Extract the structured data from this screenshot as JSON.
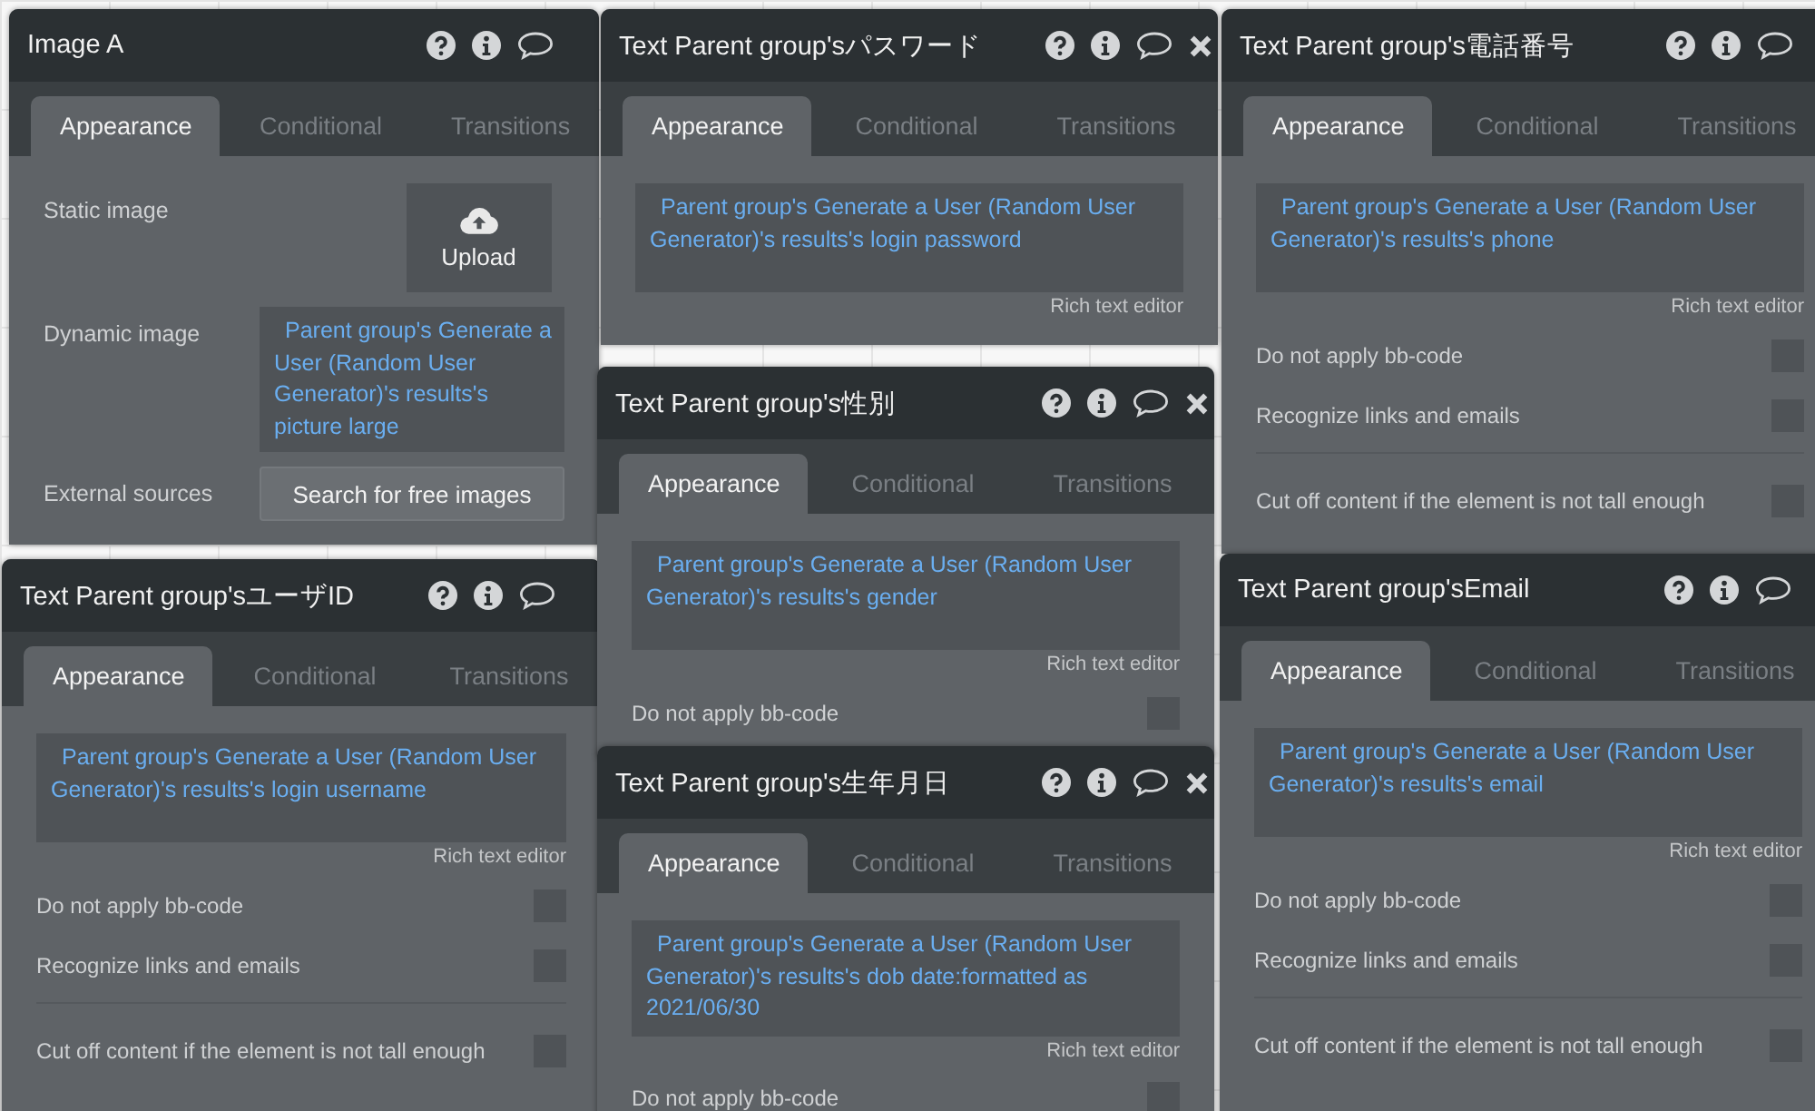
{
  "windows": [
    {
      "title": "Image A",
      "icons": [
        {
          "kind": "help"
        },
        {
          "kind": "info"
        },
        {
          "kind": "comment"
        }
      ],
      "tabs": [
        {
          "label": "Appearance",
          "selected": true
        },
        {
          "label": "Conditional",
          "selected": false
        },
        {
          "label": "Transitions",
          "selected": false
        }
      ],
      "fields": [
        {
          "kind": "upload",
          "label": "Static image",
          "button": "Upload"
        },
        {
          "kind": "dynamic",
          "label": "Dynamic image",
          "value": "Parent group's Generate a User (Random User Generator)'s results's picture large"
        },
        {
          "kind": "button",
          "label": "External sources",
          "button": "Search for free images"
        }
      ]
    },
    {
      "title": "Text Parent group'sユーザID",
      "icons": [
        {
          "kind": "help"
        },
        {
          "kind": "info"
        },
        {
          "kind": "comment"
        }
      ],
      "tabs": [
        {
          "label": "Appearance",
          "selected": true
        },
        {
          "label": "Conditional",
          "selected": false
        },
        {
          "label": "Transitions",
          "selected": false
        }
      ],
      "fields": [
        {
          "kind": "expression",
          "value": "Parent group's Generate a User (Random User Generator)'s results's login username",
          "note": "Rich text editor"
        },
        {
          "kind": "checkbox",
          "label": "Do not apply bb-code",
          "checked": false,
          "divider_above": false
        },
        {
          "kind": "checkbox",
          "label": "Recognize links and emails",
          "checked": false,
          "divider_above": false
        },
        {
          "kind": "checkbox",
          "label": "Cut off content if the element is not tall enough",
          "checked": false,
          "divider_above": true
        }
      ]
    },
    {
      "title": "Text Parent group'sパスワード",
      "icons": [
        {
          "kind": "help"
        },
        {
          "kind": "info"
        },
        {
          "kind": "comment"
        },
        {
          "kind": "close"
        }
      ],
      "tabs": [
        {
          "label": "Appearance",
          "selected": true
        },
        {
          "label": "Conditional",
          "selected": false
        },
        {
          "label": "Transitions",
          "selected": false
        }
      ],
      "fields": [
        {
          "kind": "expression",
          "value": "Parent group's Generate a User (Random User Generator)'s results's login password",
          "note": "Rich text editor"
        }
      ]
    },
    {
      "title": "Text Parent group's性別",
      "icons": [
        {
          "kind": "help"
        },
        {
          "kind": "info"
        },
        {
          "kind": "comment"
        },
        {
          "kind": "close"
        }
      ],
      "tabs": [
        {
          "label": "Appearance",
          "selected": true
        },
        {
          "label": "Conditional",
          "selected": false
        },
        {
          "label": "Transitions",
          "selected": false
        }
      ],
      "fields": [
        {
          "kind": "expression",
          "value": "Parent group's Generate a User (Random User Generator)'s results's gender",
          "note": "Rich text editor"
        },
        {
          "kind": "checkbox",
          "label": "Do not apply bb-code",
          "checked": false,
          "divider_above": false
        }
      ]
    },
    {
      "title": "Text Parent group's生年月日",
      "icons": [
        {
          "kind": "help"
        },
        {
          "kind": "info"
        },
        {
          "kind": "comment"
        },
        {
          "kind": "close"
        }
      ],
      "tabs": [
        {
          "label": "Appearance",
          "selected": true
        },
        {
          "label": "Conditional",
          "selected": false
        },
        {
          "label": "Transitions",
          "selected": false
        }
      ],
      "fields": [
        {
          "kind": "expression",
          "value": "Parent group's Generate a User (Random User Generator)'s results's dob date:formatted as 2021/06/30",
          "note": "Rich text editor"
        },
        {
          "kind": "checkbox",
          "label": "Do not apply bb-code",
          "checked": false,
          "divider_above": false
        }
      ]
    },
    {
      "title": "Text Parent group's電話番号",
      "icons": [
        {
          "kind": "help"
        },
        {
          "kind": "info"
        },
        {
          "kind": "comment"
        }
      ],
      "tabs": [
        {
          "label": "Appearance",
          "selected": true
        },
        {
          "label": "Conditional",
          "selected": false
        },
        {
          "label": "Transitions",
          "selected": false
        }
      ],
      "fields": [
        {
          "kind": "expression",
          "value": "Parent group's Generate a User (Random User Generator)'s results's phone",
          "note": "Rich text editor"
        },
        {
          "kind": "checkbox",
          "label": "Do not apply bb-code",
          "checked": false,
          "divider_above": false
        },
        {
          "kind": "checkbox",
          "label": "Recognize links and emails",
          "checked": false,
          "divider_above": false
        },
        {
          "kind": "checkbox",
          "label": "Cut off content if the element is not tall enough",
          "checked": false,
          "divider_above": true
        }
      ]
    },
    {
      "title": "Text Parent group'sEmail",
      "icons": [
        {
          "kind": "help"
        },
        {
          "kind": "info"
        },
        {
          "kind": "comment"
        }
      ],
      "tabs": [
        {
          "label": "Appearance",
          "selected": true
        },
        {
          "label": "Conditional",
          "selected": false
        },
        {
          "label": "Transitions",
          "selected": false
        }
      ],
      "fields": [
        {
          "kind": "expression",
          "value": "Parent group's Generate a User (Random User Generator)'s results's email",
          "note": "Rich text editor"
        },
        {
          "kind": "checkbox",
          "label": "Do not apply bb-code",
          "checked": false,
          "divider_above": false
        },
        {
          "kind": "checkbox",
          "label": "Recognize links and emails",
          "checked": false,
          "divider_above": false
        },
        {
          "kind": "checkbox",
          "label": "Cut off content if the element is not tall enough",
          "checked": false,
          "divider_above": true
        }
      ]
    }
  ]
}
